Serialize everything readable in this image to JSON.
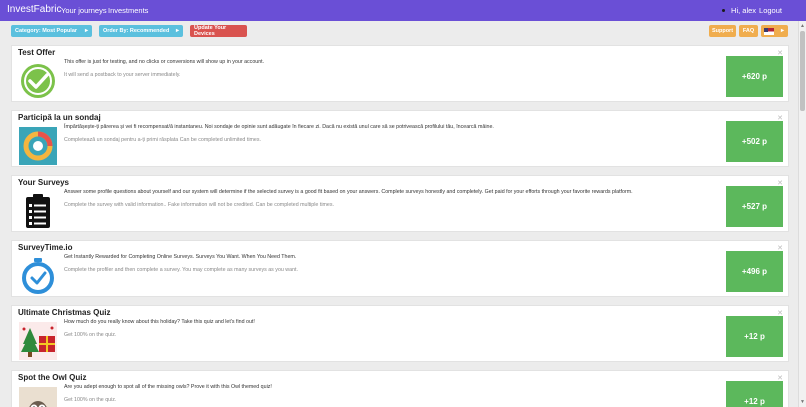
{
  "nav": {
    "brand": "InvestFabric",
    "links": [
      "Your journeys",
      "Investments"
    ],
    "greeting": "Hi, alex",
    "logout": "Logout"
  },
  "filters": {
    "category": "Category: Most Popular",
    "order": "Order By: Recommended",
    "update": "Update Your Devices",
    "support": "Support",
    "faq": "FAQ"
  },
  "colors": {
    "navbar": "#6a4fd6",
    "info_button": "#5bc0de",
    "danger_button": "#d9534f",
    "warning_button": "#f0ad4e",
    "points_button": "#5cb85c"
  },
  "offers": [
    {
      "title": "Test Offer",
      "description": "This offer is just for testing, and no clicks or conversions will show up in your account.",
      "note": "It will send a postback to your server immediately.",
      "points": "+620 p",
      "icon": "green-check-icon"
    },
    {
      "title": "Participă la un sondaj",
      "description": "Împărtășește-ți părerea și vei fi recompensat/ă instantaneu. Noi sondaje de opinie sunt adăugate în fiecare zi. Dacă nu există unul care să se potrivească profilului tău, încearcă mâine.",
      "note": "Completează un sondaj pentru a-ți primi răsplata Can be completed unlimited times.",
      "points": "+502 p",
      "icon": "survey-ring-icon"
    },
    {
      "title": "Your Surveys",
      "description": "Answer some profile questions about yourself and our system will determine if the selected survey is a good fit based on your answers. Complete surveys honestly and completely. Get paid for your efforts through your favorite rewards platform.",
      "note": "Complete the survey with valid information.. Fake information will not be credited. Can be completed multiple times.",
      "points": "+527 p",
      "icon": "clipboard-icon"
    },
    {
      "title": "SurveyTime.io",
      "description": "Get Instantly Rewarded for Completing Online Surveys. Surveys You Want. When You Need Them.",
      "note": "Complete the profiler and then complete a survey. You may complete as many surveys as you want.",
      "points": "+496 p",
      "icon": "stopwatch-icon"
    },
    {
      "title": "Ultimate Christmas Quiz",
      "description": "How much do you really know about this holiday? Take this quiz and let's find out!",
      "note": "Get 100% on the quiz.",
      "points": "+12 p",
      "icon": "christmas-quiz-icon"
    },
    {
      "title": "Spot the Owl Quiz",
      "description": "Are you adept enough to spot all of the missing owls? Prove it with this Owl themed quiz!",
      "note": "Get 100% on the quiz.",
      "points": "+12 p",
      "icon": "owl-icon"
    }
  ]
}
